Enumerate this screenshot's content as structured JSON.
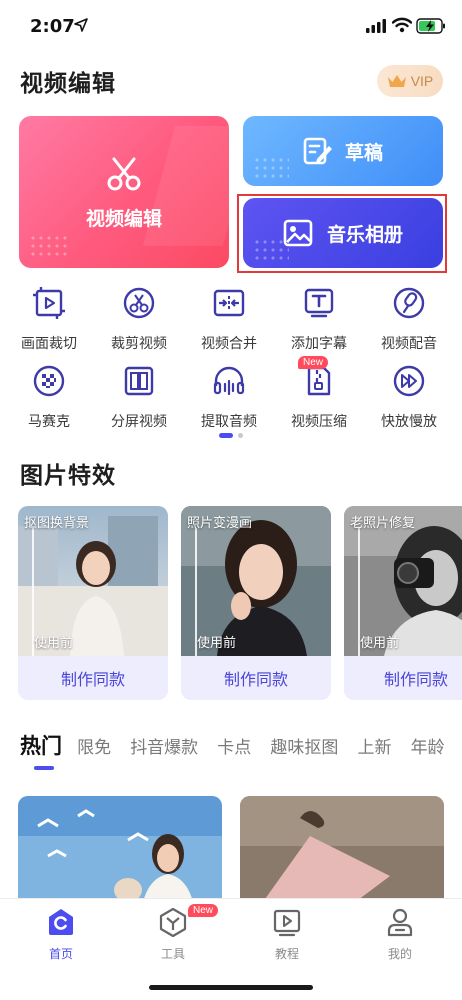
{
  "status_bar": {
    "time": "2:07"
  },
  "header": {
    "title": "视频编辑",
    "vip_label": "VIP"
  },
  "main_cards": {
    "video_edit": "视频编辑",
    "draft": "草稿",
    "music_album": "音乐相册"
  },
  "tools": [
    {
      "label": "画面裁切",
      "icon": "crop-icon"
    },
    {
      "label": "裁剪视频",
      "icon": "cut-video-icon"
    },
    {
      "label": "视频合并",
      "icon": "merge-icon"
    },
    {
      "label": "添加字幕",
      "icon": "subtitle-icon"
    },
    {
      "label": "视频配音",
      "icon": "dubbing-icon"
    },
    {
      "label": "马赛克",
      "icon": "mosaic-icon"
    },
    {
      "label": "分屏视频",
      "icon": "split-screen-icon"
    },
    {
      "label": "提取音频",
      "icon": "extract-audio-icon"
    },
    {
      "label": "视频压缩",
      "icon": "compress-icon",
      "badge": "New"
    },
    {
      "label": "快放慢放",
      "icon": "speed-icon"
    }
  ],
  "image_effects": {
    "title": "图片特效",
    "cards": [
      {
        "tag": "抠图换背景",
        "before": "使用前",
        "button": "制作同款"
      },
      {
        "tag": "照片变漫画",
        "before": "使用前",
        "button": "制作同款"
      },
      {
        "tag": "老照片修复",
        "before": "使用前",
        "button": "制作同款"
      }
    ]
  },
  "hot_tabs": [
    "热门",
    "限免",
    "抖音爆款",
    "卡点",
    "趣味抠图",
    "上新",
    "年龄"
  ],
  "bottom_nav": [
    {
      "label": "首页",
      "icon": "home-icon",
      "active": true
    },
    {
      "label": "工具",
      "icon": "tools-icon",
      "badge": "New"
    },
    {
      "label": "教程",
      "icon": "tutorial-icon"
    },
    {
      "label": "我的",
      "icon": "profile-icon"
    }
  ],
  "colors": {
    "accent": "#4c4cf0",
    "edit_card": "#fb5a7e",
    "draft_card": "#4a95f8",
    "music_card": "#4a46e8",
    "new_badge": "#ff4b5c"
  }
}
